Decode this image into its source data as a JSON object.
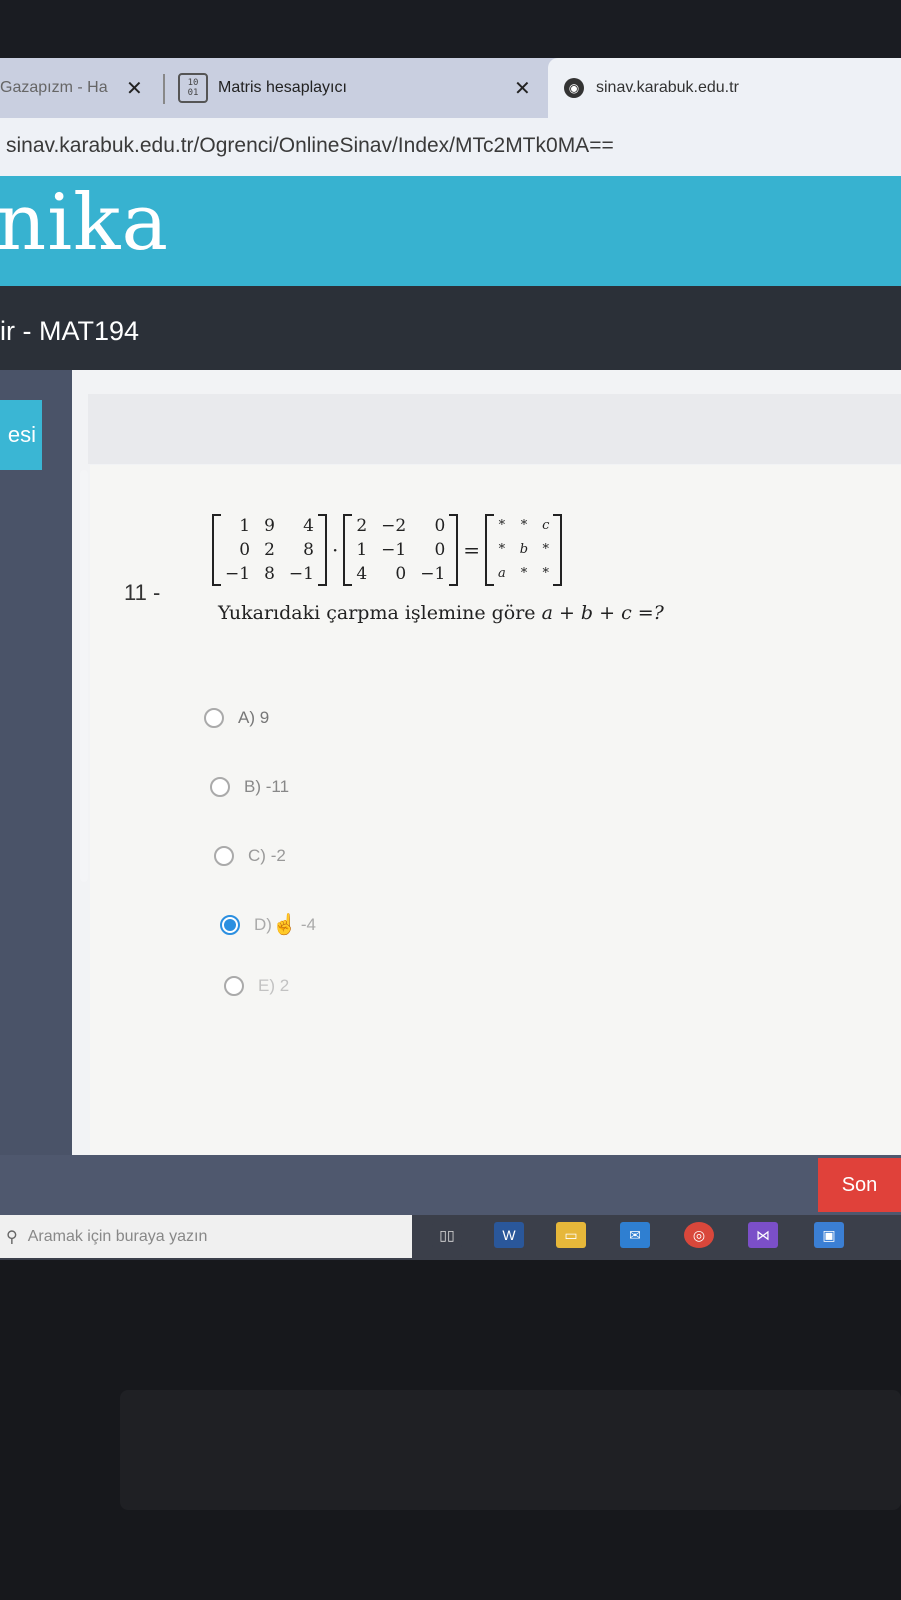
{
  "browser": {
    "tabs": [
      {
        "label": "Gazapızm - Ha",
        "close": "✕"
      },
      {
        "label": "Matris hesaplayıcı",
        "close": "✕",
        "favicon_text": "10\n01"
      },
      {
        "label": "sinav.karabuk.edu.tr"
      }
    ],
    "url": "sinav.karabuk.edu.tr/Ogrenci/OnlineSinav/Index/MTc2MTk0MA=="
  },
  "site": {
    "logo_text": "nika",
    "course_title": "ir - MAT194",
    "side_tab_label": "esi"
  },
  "question": {
    "number": "11 -",
    "matrix_a": [
      "1",
      "9",
      "4",
      "0",
      "2",
      "8",
      "−1",
      "8",
      "−1"
    ],
    "matrix_b": [
      "2",
      "−2",
      "0",
      "1",
      "−1",
      "0",
      "4",
      "0",
      "−1"
    ],
    "matrix_c": [
      "*",
      "*",
      "c",
      "*",
      "b",
      "*",
      "a",
      "*",
      "*"
    ],
    "dot": "·",
    "equals": "=",
    "text_prefix": "Yukarıdaki çarpma işlemine göre ",
    "text_expr": "a + b + c =?"
  },
  "options": [
    {
      "label": "A)",
      "value": "9",
      "selected": false
    },
    {
      "label": "B)",
      "value": "-11",
      "selected": false
    },
    {
      "label": "C)",
      "value": "-2",
      "selected": false
    },
    {
      "label": "D)",
      "value": "-4",
      "selected": true
    },
    {
      "label": "E)",
      "value": "2",
      "selected": false
    }
  ],
  "footer": {
    "next_button": "Son"
  },
  "taskbar": {
    "search_placeholder": "Aramak için buraya yazın",
    "icons": [
      "task-view-icon",
      "word-icon",
      "file-explorer-icon",
      "mail-icon",
      "chrome-icon",
      "visual-studio-icon",
      "store-icon"
    ]
  },
  "colors": {
    "accent": "#37b2d0",
    "selected_radio": "#2b8fe0",
    "next_button": "#e0413a"
  }
}
